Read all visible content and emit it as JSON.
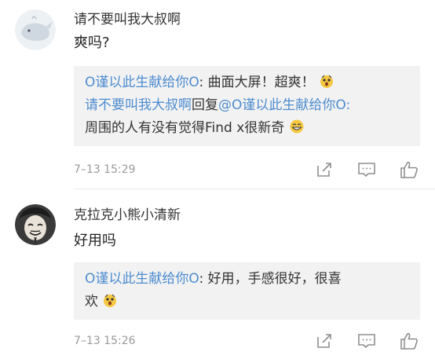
{
  "comments": [
    {
      "author": "请不要叫我大叔啊",
      "text": "爽吗?",
      "replies": [
        {
          "parts": [
            {
              "t": "O谨以此生献给你O",
              "link": true
            },
            {
              "t": ": 曲面大屏！超爽！",
              "link": false
            }
          ],
          "emoji": "shocked-emoji"
        },
        {
          "parts": [
            {
              "t": "请不要叫我大叔啊",
              "link": true
            },
            {
              "t": "回复",
              "link": false
            },
            {
              "t": "@O谨以此生献给你O",
              "link": true
            },
            {
              "t": ":",
              "link": false
            }
          ]
        },
        {
          "parts": [
            {
              "t": "周围的人有没有觉得Find x很新奇",
              "link": false
            }
          ],
          "emoji": "grin-emoji"
        }
      ],
      "time": "7–13 15:29"
    },
    {
      "author": "克拉克小熊小清新",
      "text": "好用吗",
      "replies": [
        {
          "parts": [
            {
              "t": "O谨以此生献给你O",
              "link": true
            },
            {
              "t": ": 好用，手感很好，很喜",
              "link": false
            }
          ]
        },
        {
          "parts": [
            {
              "t": "欢",
              "link": false
            }
          ],
          "emoji": "shocked-emoji"
        }
      ],
      "time": "7–13 15:26"
    }
  ],
  "actions": {
    "icons": [
      "share-icon",
      "comment-icon",
      "like-icon"
    ]
  },
  "colors": {
    "link": "#4d8ccf",
    "reply_bg": "#f2f2f2",
    "meta": "#9a9a9a"
  }
}
